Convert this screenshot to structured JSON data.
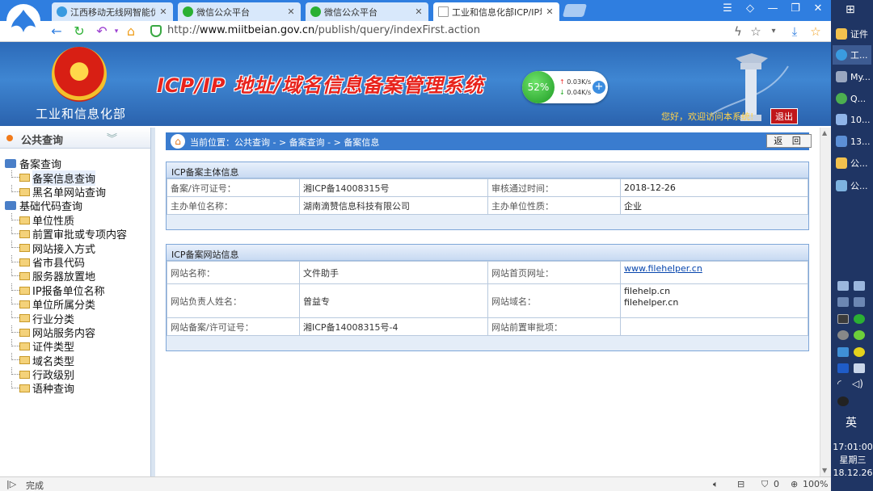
{
  "browser": {
    "tabs": [
      {
        "label": "江西移动无线网智能优化",
        "icon_color": "#3a9be0",
        "active": false
      },
      {
        "label": "微信公众平台",
        "icon_color": "#2bb033",
        "active": false
      },
      {
        "label": "微信公众平台",
        "icon_color": "#2bb033",
        "active": false
      },
      {
        "label": "工业和信息化部ICP/IP地",
        "icon_color": "#999999",
        "active": true
      }
    ],
    "url_prefix": "http://",
    "url_host": "www.miitbeian.gov.cn",
    "url_path": "/publish/query/indexFirst.action"
  },
  "banner": {
    "ministry": "工业和信息化部",
    "title": "ICP/IP 地址/域名信息备案管理系统",
    "speed_percent": "52%",
    "upload": "0.03K/s",
    "download": "0.04K/s",
    "welcome": "您好，欢迎访问本系统!",
    "logout": "退出"
  },
  "leftnav": {
    "heading": "公共查询",
    "items": [
      {
        "label": "备案查询",
        "type": "group"
      },
      {
        "label": "备案信息查询",
        "type": "leaf",
        "selected": true
      },
      {
        "label": "黑名单网站查询",
        "type": "leaf"
      },
      {
        "label": "基础代码查询",
        "type": "group"
      },
      {
        "label": "单位性质",
        "type": "leaf"
      },
      {
        "label": "前置审批或专项内容",
        "type": "leaf"
      },
      {
        "label": "网站接入方式",
        "type": "leaf"
      },
      {
        "label": "省市县代码",
        "type": "leaf"
      },
      {
        "label": "服务器放置地",
        "type": "leaf"
      },
      {
        "label": "IP报备单位名称",
        "type": "leaf"
      },
      {
        "label": "单位所属分类",
        "type": "leaf"
      },
      {
        "label": "行业分类",
        "type": "leaf"
      },
      {
        "label": "网站服务内容",
        "type": "leaf"
      },
      {
        "label": "证件类型",
        "type": "leaf"
      },
      {
        "label": "域名类型",
        "type": "leaf"
      },
      {
        "label": "行政级别",
        "type": "leaf"
      },
      {
        "label": "语种查询",
        "type": "leaf"
      }
    ]
  },
  "main": {
    "breadcrumb": "当前位置：公共查询  - > 备案查询  - > 备案信息",
    "back_label": "返 回",
    "subject_panel": {
      "title": "ICP备案主体信息",
      "rows": [
        [
          "备案/许可证号：",
          "湘ICP备14008315号",
          "审核通过时间：",
          "2018-12-26"
        ],
        [
          "主办单位名称：",
          "湖南滴赞信息科技有限公司",
          "主办单位性质：",
          "企业"
        ]
      ]
    },
    "site_panel": {
      "title": "ICP备案网站信息",
      "site_name_label": "网站名称：",
      "site_name": "文件助手",
      "home_url_label": "网站首页网址：",
      "home_url": "www.filehelper.cn",
      "owner_label": "网站负责人姓名：",
      "owner": "曾益专",
      "domain_label": "网站域名：",
      "domain_1": "filehelp.cn",
      "domain_2": "filehelper.cn",
      "license_label": "网站备案/许可证号：",
      "license": "湘ICP备14008315号-4",
      "approval_label": "网站前置审批项：",
      "approval": ""
    }
  },
  "statusbar": {
    "status": "完成",
    "shield_count": "0",
    "zoom": "100%"
  },
  "taskbar": {
    "items": [
      {
        "label": "证件",
        "icon_color": "#f2c14e"
      },
      {
        "label": "工...",
        "icon_color": "#3a9be0",
        "active": true
      },
      {
        "label": "My...",
        "icon_color": "#9aa7c0"
      },
      {
        "label": "Q...",
        "icon_color": "#4caf50"
      },
      {
        "label": "10...",
        "icon_color": "#8fb4e8"
      },
      {
        "label": "13...",
        "icon_color": "#5c8fd6"
      },
      {
        "label": "公...",
        "icon_color": "#f2c14e"
      },
      {
        "label": "公...",
        "icon_color": "#7db3e0"
      }
    ],
    "ime": "英",
    "time": "17:01:00",
    "weekday": "星期三",
    "date": "18.12.26"
  }
}
